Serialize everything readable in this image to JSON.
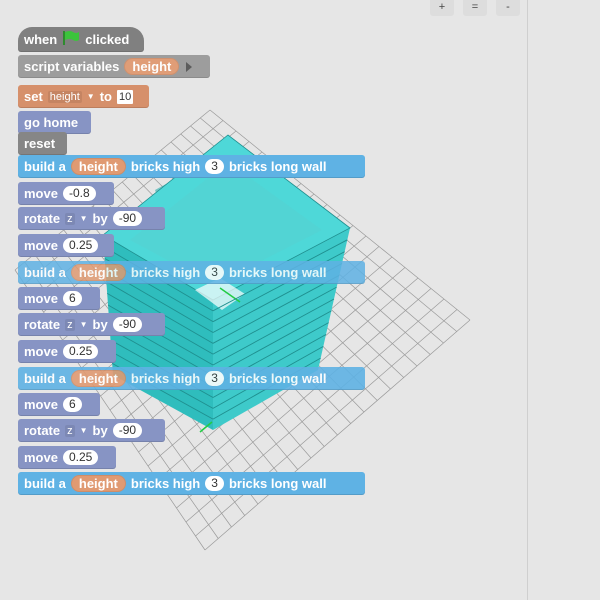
{
  "zoom": {
    "plus": "+",
    "equals": "=",
    "minus": "-"
  },
  "script": {
    "hat": {
      "when": "when",
      "clicked": "clicked",
      "icon": "green-flag-icon"
    },
    "script_vars": {
      "label": "script variables",
      "var": "height"
    },
    "set": {
      "label": "set",
      "var": "height",
      "to": "to",
      "value": "10"
    },
    "go_home": "go home",
    "reset": "reset",
    "build1": {
      "a": "build a",
      "var": "height",
      "high": "bricks high",
      "count": "3",
      "long": "bricks long wall"
    },
    "move1": {
      "label": "move",
      "value": "-0.8"
    },
    "rotate1": {
      "label": "rotate",
      "axis": "z",
      "by": "by",
      "value": "-90"
    },
    "move2": {
      "label": "move",
      "value": "0.25"
    },
    "build2": {
      "a": "build a",
      "var": "height",
      "high": "bricks high",
      "count": "3",
      "long": "bricks long wall"
    },
    "move3": {
      "label": "move",
      "value": "6"
    },
    "rotate2": {
      "label": "rotate",
      "axis": "z",
      "by": "by",
      "value": "-90"
    },
    "move4": {
      "label": "move",
      "value": "0.25"
    },
    "build3": {
      "a": "build a",
      "var": "height",
      "high": "bricks high",
      "count": "3",
      "long": "bricks long wall"
    },
    "move5": {
      "label": "move",
      "value": "6"
    },
    "rotate3": {
      "label": "rotate",
      "axis": "z",
      "by": "by",
      "value": "-90"
    },
    "move6": {
      "label": "move",
      "value": "0.25"
    },
    "build4": {
      "a": "build a",
      "var": "height",
      "high": "bricks high",
      "count": "3",
      "long": "bricks long wall"
    }
  },
  "colors": {
    "brick_top": "#4ed0d0",
    "brick_side": "#2fbdbd",
    "brick_dark": "#1f8f8f",
    "grid": "#9a9a9a",
    "axis_green": "#22cc44"
  }
}
